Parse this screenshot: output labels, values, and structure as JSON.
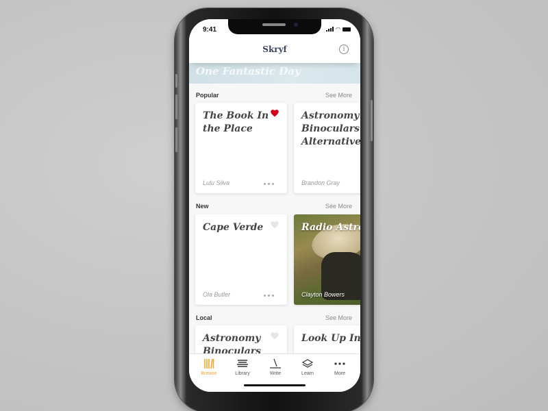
{
  "status_bar": {
    "time": "9:41"
  },
  "nav": {
    "title": "Skryf",
    "info_icon": "info-icon"
  },
  "banner": {
    "title": "One Fantastic Day"
  },
  "sections": [
    {
      "title": "Popular",
      "see_more": "See More",
      "cards": [
        {
          "title": "The Book In the Place",
          "author": "Lulu Silva",
          "favorited": true
        },
        {
          "title": "Astronomy Binoculars A Great Alternative",
          "author": "Brandon Gray",
          "favorited": false
        }
      ]
    },
    {
      "title": "New",
      "see_more": "See More",
      "cards": [
        {
          "title": "Cape Verde",
          "author": "Ola Butler",
          "favorited": false
        },
        {
          "title": "Radio Astronomy",
          "author": "Clayton Bowers",
          "favorited": false,
          "has_image": true
        }
      ]
    },
    {
      "title": "Local",
      "see_more": "See More",
      "cards": [
        {
          "title": "Astronomy Binoculars",
          "author": "",
          "favorited": false
        },
        {
          "title": "Look Up In The Sky",
          "author": "",
          "favorited": false
        }
      ]
    }
  ],
  "tab_bar": {
    "active": "Browse",
    "accent_color": "#f2a531",
    "tabs": [
      {
        "label": "Browse",
        "icon": "browse-icon"
      },
      {
        "label": "Library",
        "icon": "library-icon"
      },
      {
        "label": "Write",
        "icon": "write-icon"
      },
      {
        "label": "Learn",
        "icon": "learn-icon"
      },
      {
        "label": "More",
        "icon": "more-icon"
      }
    ]
  },
  "colors": {
    "heart_active": "#d0021b",
    "heart_inactive": "#e6e6e6",
    "title_navy": "#3a3f5c"
  }
}
